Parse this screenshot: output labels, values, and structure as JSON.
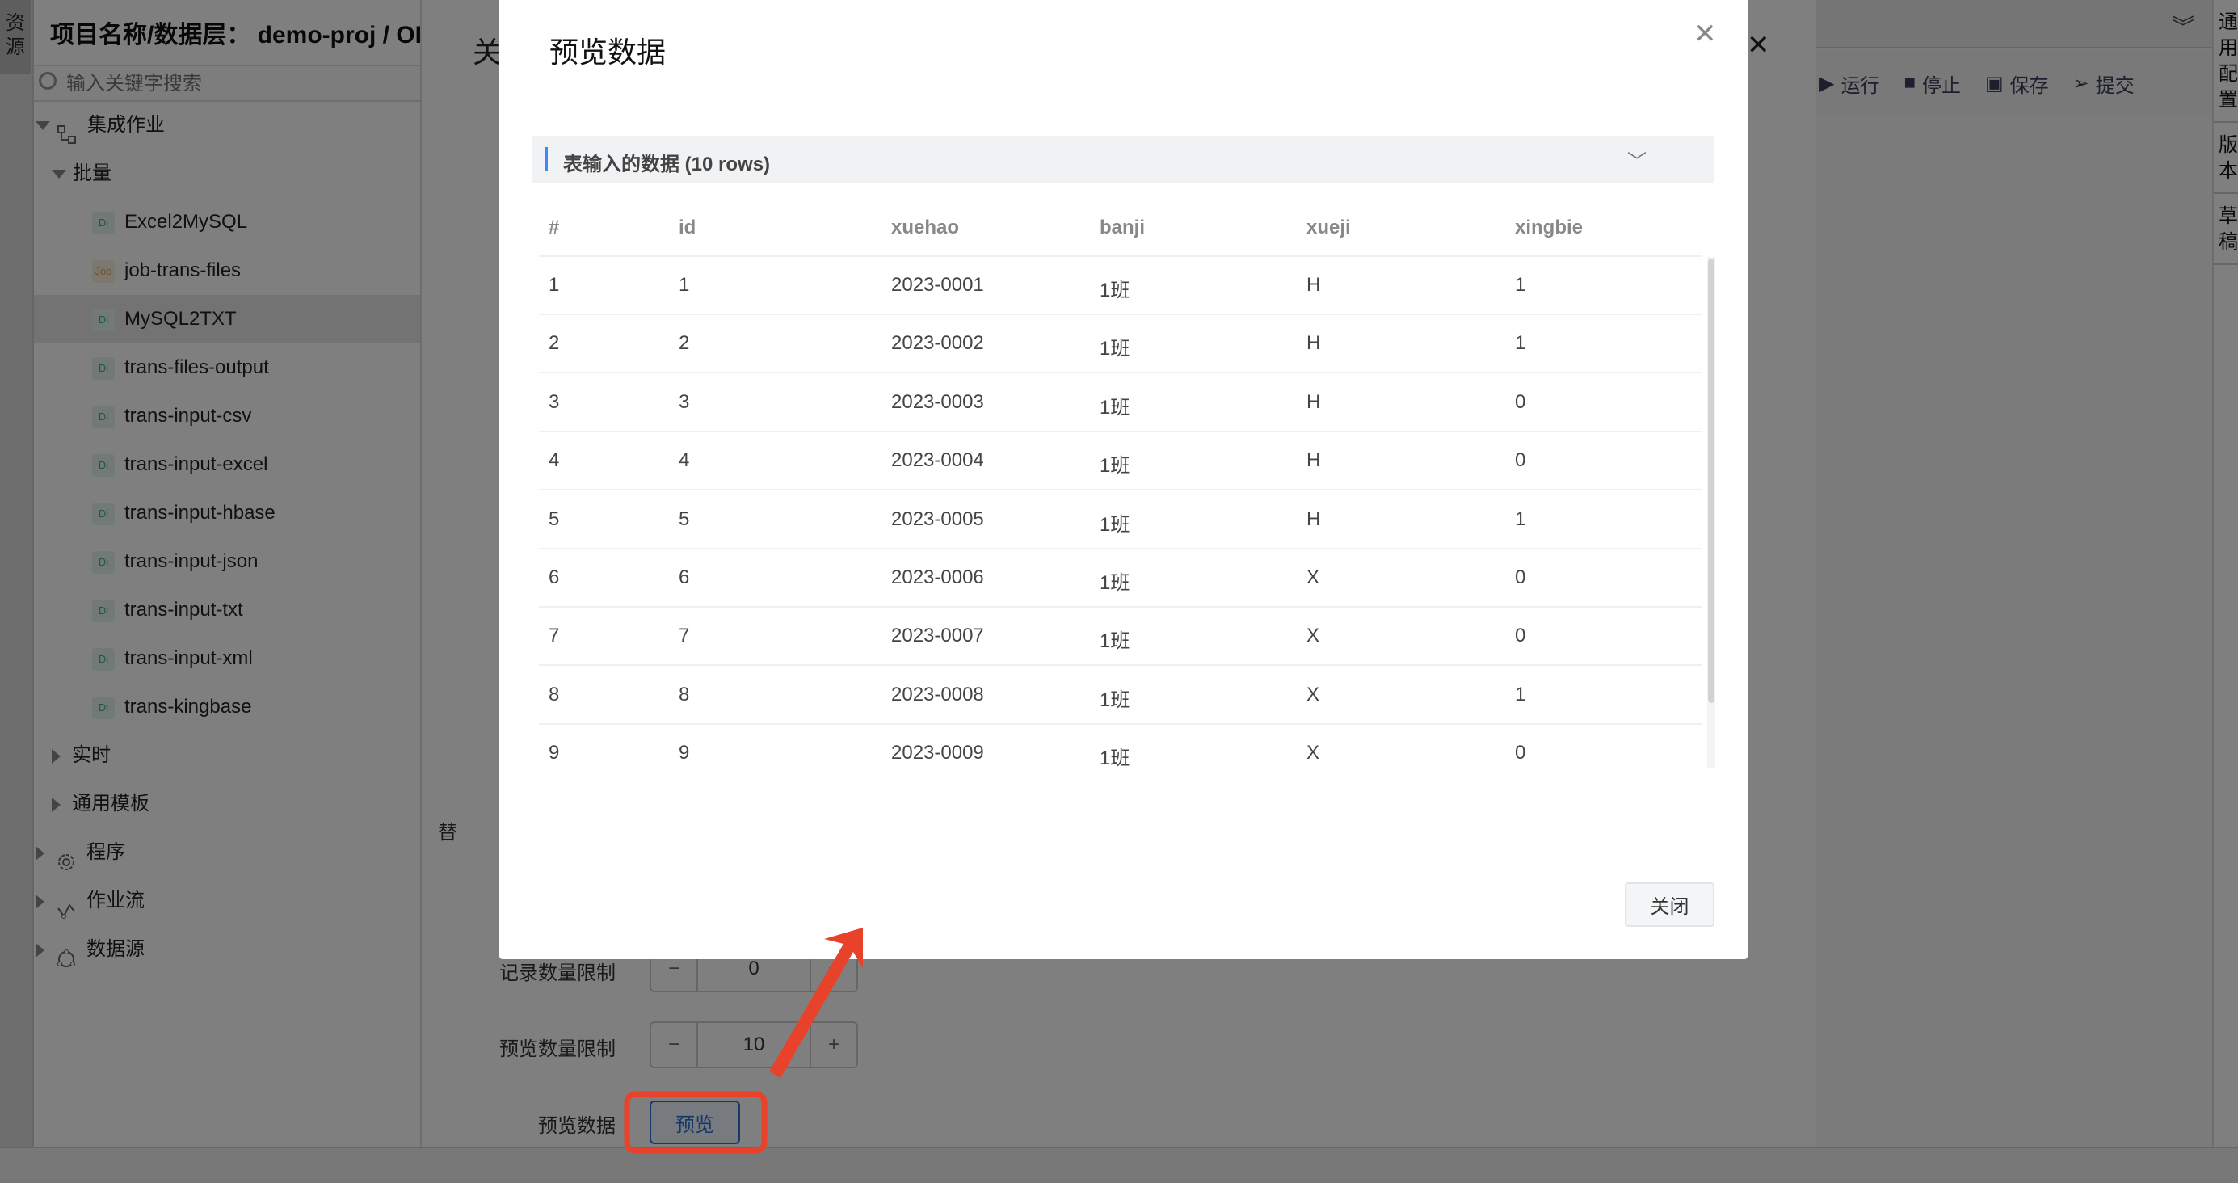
{
  "left_tab": {
    "label": "资源"
  },
  "sidebar": {
    "title": "项目名称/数据层： demo-proj / ODS",
    "search_placeholder": "输入关键字搜索",
    "items": [
      {
        "label": "集成作业",
        "level": 0,
        "expanded": true,
        "icon": "integration-icon"
      },
      {
        "label": "批量",
        "level": 1,
        "expanded": true
      },
      {
        "label": "Excel2MySQL",
        "level": 2,
        "badge": "Di"
      },
      {
        "label": "job-trans-files",
        "level": 2,
        "badge": "Job"
      },
      {
        "label": "MySQL2TXT",
        "level": 2,
        "badge": "Di",
        "selected": true
      },
      {
        "label": "trans-files-output",
        "level": 2,
        "badge": "Di"
      },
      {
        "label": "trans-input-csv",
        "level": 2,
        "badge": "Di"
      },
      {
        "label": "trans-input-excel",
        "level": 2,
        "badge": "Di"
      },
      {
        "label": "trans-input-hbase",
        "level": 2,
        "badge": "Di"
      },
      {
        "label": "trans-input-json",
        "level": 2,
        "badge": "Di"
      },
      {
        "label": "trans-input-txt",
        "level": 2,
        "badge": "Di"
      },
      {
        "label": "trans-input-xml",
        "level": 2,
        "badge": "Di"
      },
      {
        "label": "trans-kingbase",
        "level": 2,
        "badge": "Di"
      },
      {
        "label": "实时",
        "level": 1,
        "expanded": false
      },
      {
        "label": "通用模板",
        "level": 1,
        "expanded": false
      },
      {
        "label": "程序",
        "level": 0,
        "expanded": false,
        "icon": "gear-icon"
      },
      {
        "label": "作业流",
        "level": 0,
        "expanded": false,
        "icon": "workflow-icon"
      },
      {
        "label": "数据源",
        "level": 0,
        "expanded": false,
        "icon": "datasource-icon"
      }
    ]
  },
  "drawer": {
    "title": "关",
    "partial_label": "替",
    "record_limit": {
      "label": "记录数量限制",
      "value": "0"
    },
    "preview_limit": {
      "label": "预览数量限制",
      "value": "10"
    },
    "preview_data": {
      "label": "预览数据",
      "button": "预览"
    }
  },
  "toolbar": {
    "run": "运行",
    "stop": "停止",
    "save": "保存",
    "submit": "提交"
  },
  "right_tabs": [
    "通用配置",
    "版本",
    "草稿"
  ],
  "modal": {
    "title": "预览数据",
    "section_title": "表输入的数据 (10 rows)",
    "columns": [
      "#",
      "id",
      "xuehao",
      "banji",
      "xueji",
      "xingbie"
    ],
    "rows": [
      [
        "1",
        "1",
        "2023-0001",
        "1班",
        "H",
        "1"
      ],
      [
        "2",
        "2",
        "2023-0002",
        "1班",
        "H",
        "1"
      ],
      [
        "3",
        "3",
        "2023-0003",
        "1班",
        "H",
        "0"
      ],
      [
        "4",
        "4",
        "2023-0004",
        "1班",
        "H",
        "0"
      ],
      [
        "5",
        "5",
        "2023-0005",
        "1班",
        "H",
        "1"
      ],
      [
        "6",
        "6",
        "2023-0006",
        "1班",
        "X",
        "0"
      ],
      [
        "7",
        "7",
        "2023-0007",
        "1班",
        "X",
        "0"
      ],
      [
        "8",
        "8",
        "2023-0008",
        "1班",
        "X",
        "1"
      ],
      [
        "9",
        "9",
        "2023-0009",
        "1班",
        "X",
        "0"
      ]
    ],
    "close_button": "关闭"
  },
  "annotation_color": "#e8432a"
}
